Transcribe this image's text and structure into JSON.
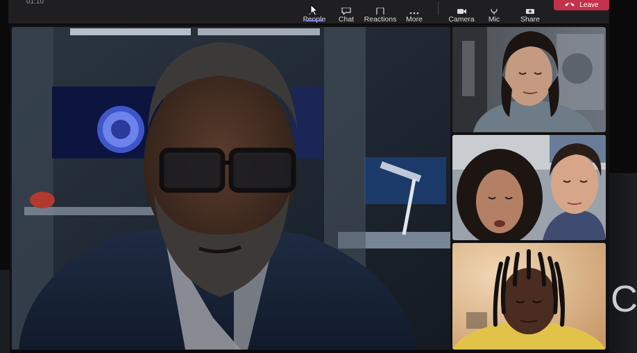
{
  "call": {
    "timer": "01:10"
  },
  "toolbar": {
    "people_label": "People",
    "chat_label": "Chat",
    "reactions_label": "Reactions",
    "more_label": "More",
    "camera_label": "Camera",
    "mic_label": "Mic",
    "share_label": "Share",
    "leave_label": "Leave"
  },
  "colors": {
    "toolbar_bg": "#1f1f21",
    "leave_red": "#c4314b",
    "active_underline": "#7f85f5"
  },
  "icons": {
    "people": "people-icon",
    "chat": "chat-icon",
    "reactions": "reactions-icon",
    "more": "more-icon",
    "camera": "camera-icon",
    "mic": "mic-icon",
    "share": "share-icon",
    "leave": "phone-hangup-icon"
  },
  "participants": [
    {
      "tile": "main-speaker"
    },
    {
      "tile": "participant-woman-lab"
    },
    {
      "tile": "participant-pair"
    },
    {
      "tile": "participant-dreadlocks"
    }
  ]
}
